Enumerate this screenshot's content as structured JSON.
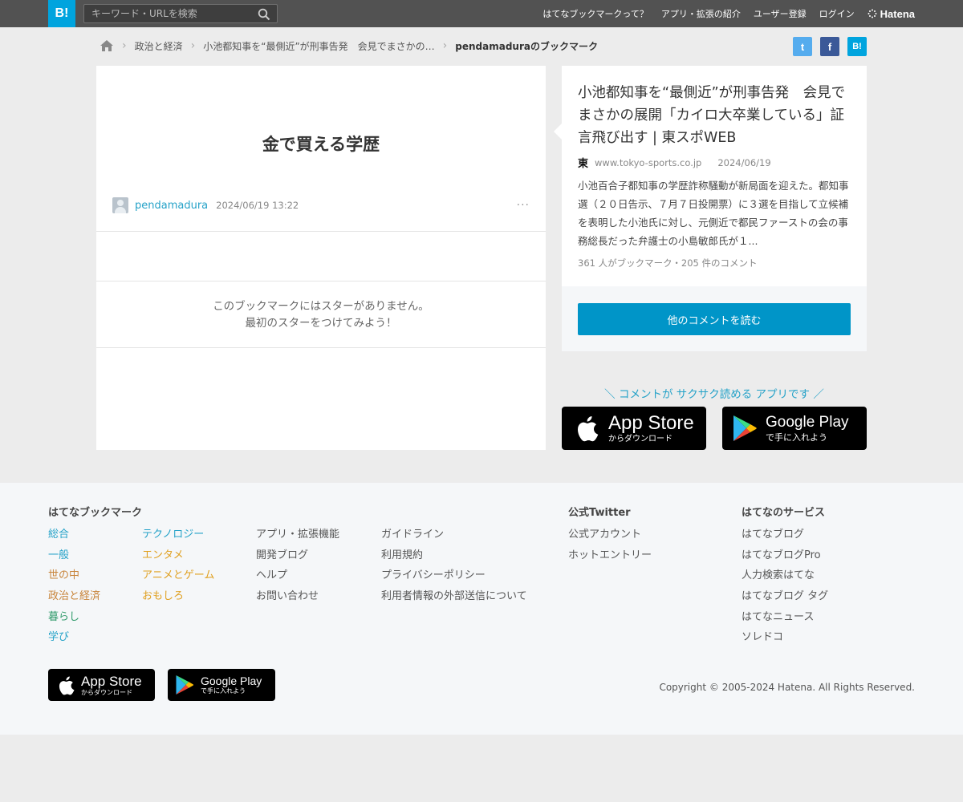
{
  "header": {
    "logo_text": "B!",
    "search_placeholder": "キーワード・URLを検索",
    "nav": [
      "はてなブックマークって？",
      "アプリ・拡張の紹介",
      "ユーザー登録",
      "ログイン"
    ],
    "brand": "Hatena"
  },
  "breadcrumb": {
    "items": [
      "政治と経済",
      "小池都知事を“最側近”が刑事告発　会見でまさかの…"
    ],
    "current": "pendamaduraのブックマーク"
  },
  "share": {
    "twitter_glyph": "t",
    "facebook_glyph": "f",
    "hatena_glyph": "B!"
  },
  "bookmark": {
    "comment": "金で買える学歴",
    "user": "pendamadura",
    "datetime": "2024/06/19 13:22",
    "more": "···",
    "no_star_line1": "このブックマークにはスターがありません。",
    "no_star_line2": "最初のスターをつけてみよう！"
  },
  "entry": {
    "title": "小池都知事を“最側近”が刑事告発　会見でまさかの展開「カイロ大卒業している」証言飛び出す | 東スポWEB",
    "favicon": "東",
    "domain": "www.tokyo-sports.co.jp",
    "date": "2024/06/19",
    "description": "小池百合子都知事の学歴詐称騒動が新局面を迎えた。都知事選（２０日告示、７月７日投開票）に３選を目指して立候補を表明した小池氏に対し、元側近で都民ファーストの会の事務総長だった弁護士の小島敏郎氏が１...",
    "counts": "361 人がブックマーク・205 件のコメント",
    "read_button": "他のコメントを読む"
  },
  "promo": {
    "text": "＼ コメントが サクサク読める アプリです ／",
    "appstore_main": "App Store",
    "appstore_sub": "からダウンロード",
    "googleplay_main": "Google Play",
    "googleplay_sub": "で手に入れよう"
  },
  "footer": {
    "col1_title": "はてなブックマーク",
    "categories_a": [
      {
        "label": "総合",
        "color": "#25a2c8"
      },
      {
        "label": "一般",
        "color": "#25a2c8"
      },
      {
        "label": "世の中",
        "color": "#c8843a"
      },
      {
        "label": "政治と経済",
        "color": "#c8843a"
      },
      {
        "label": "暮らし",
        "color": "#2f9a6a"
      },
      {
        "label": "学び",
        "color": "#25a2c8"
      }
    ],
    "categories_b": [
      {
        "label": "テクノロジー",
        "color": "#25a2c8"
      },
      {
        "label": "エンタメ",
        "color": "#e0a020"
      },
      {
        "label": "アニメとゲーム",
        "color": "#e0a020"
      },
      {
        "label": "おもしろ",
        "color": "#e0a020"
      }
    ],
    "links_c": [
      "アプリ・拡張機能",
      "開発ブログ",
      "ヘルプ",
      "お問い合わせ"
    ],
    "links_d": [
      "ガイドライン",
      "利用規約",
      "プライバシーポリシー",
      "利用者情報の外部送信について"
    ],
    "twitter_title": "公式Twitter",
    "twitter_links": [
      "公式アカウント",
      "ホットエントリー"
    ],
    "services_title": "はてなのサービス",
    "services": [
      "はてなブログ",
      "はてなブログPro",
      "人力検索はてな",
      "はてなブログ タグ",
      "はてなニュース",
      "ソレドコ"
    ],
    "copyright": "Copyright © 2005-2024 Hatena. All Rights Reserved."
  }
}
